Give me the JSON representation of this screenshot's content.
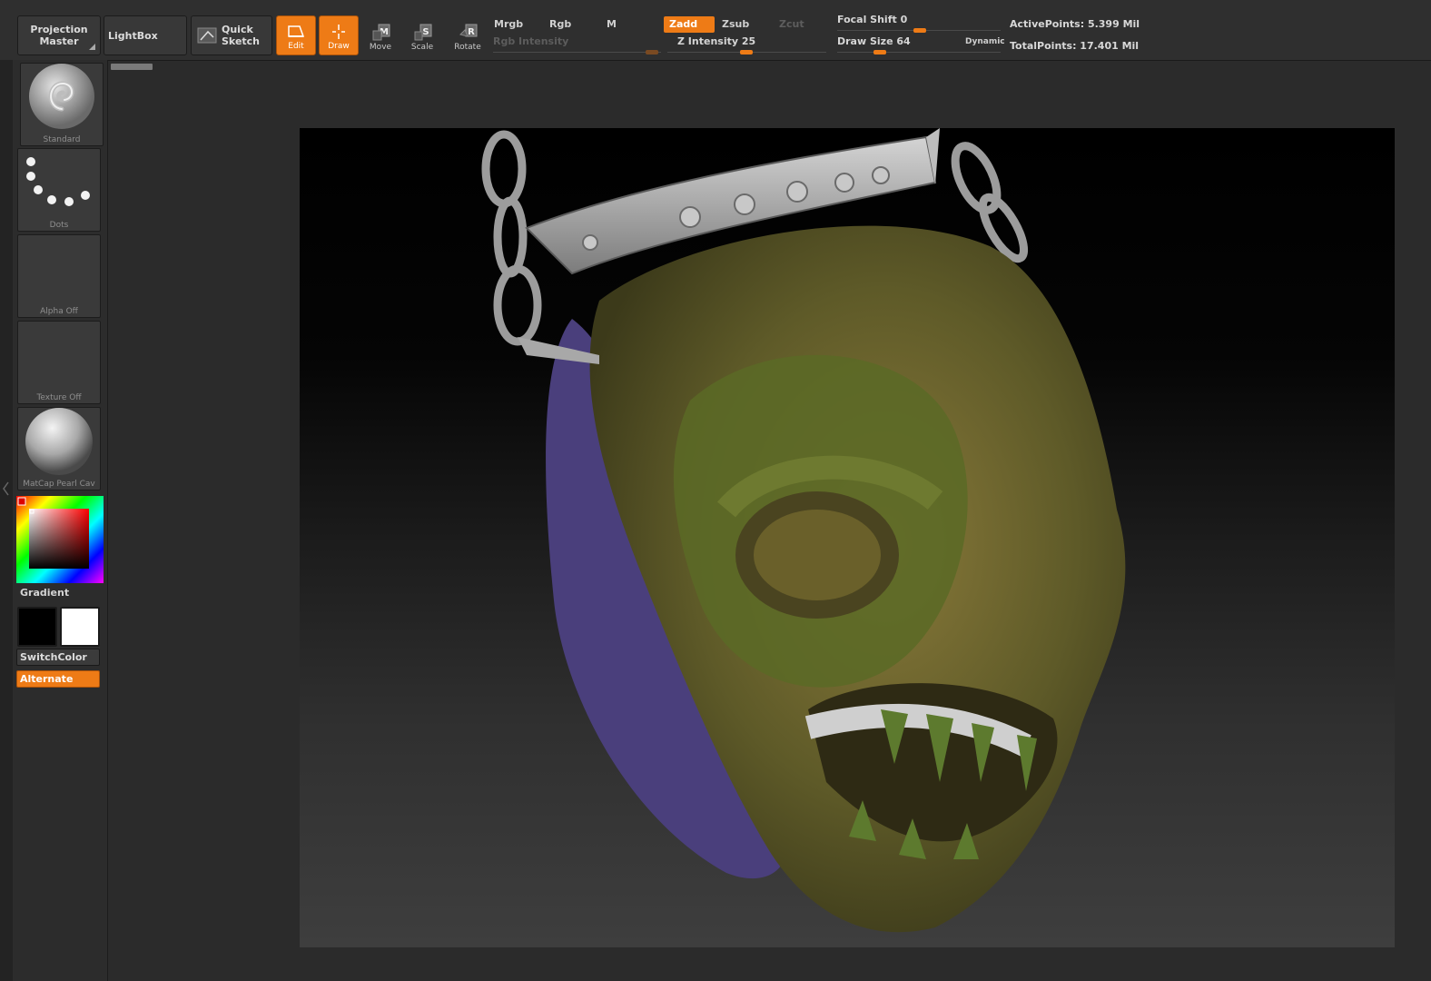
{
  "toolbar": {
    "projection_master": "Projection\nMaster",
    "lightbox": "LightBox",
    "quick_sketch": "Quick\nSketch",
    "modes": {
      "edit": "Edit",
      "draw": "Draw",
      "move": "Move",
      "scale": "Scale",
      "rotate": "Rotate"
    },
    "mrgb": "Mrgb",
    "rgb": "Rgb",
    "m": "M",
    "zadd": "Zadd",
    "zsub": "Zsub",
    "zcut": "Zcut",
    "rgb_intensity_label": "Rgb Intensity",
    "z_intensity_label": "Z Intensity 25",
    "focal_shift_label": "Focal Shift 0",
    "draw_size_label": "Draw Size 64",
    "dynamic": "Dynamic",
    "active_points": "ActivePoints: 5.399 Mil",
    "total_points": "TotalPoints: 17.401 Mil",
    "values": {
      "rgb_intensity": 100,
      "z_intensity": 25,
      "focal_shift": 0,
      "draw_size": 64
    }
  },
  "left_panel": {
    "brush": "Standard",
    "stroke": "Dots",
    "alpha": "Alpha Off",
    "texture": "Texture Off",
    "material": "MatCap Pearl Cav",
    "gradient_label": "Gradient",
    "switch_color": "SwitchColor",
    "alternate": "Alternate"
  },
  "colors": {
    "accent": "#ee7b16",
    "main_color": "#000000",
    "secondary_color": "#ffffff"
  }
}
